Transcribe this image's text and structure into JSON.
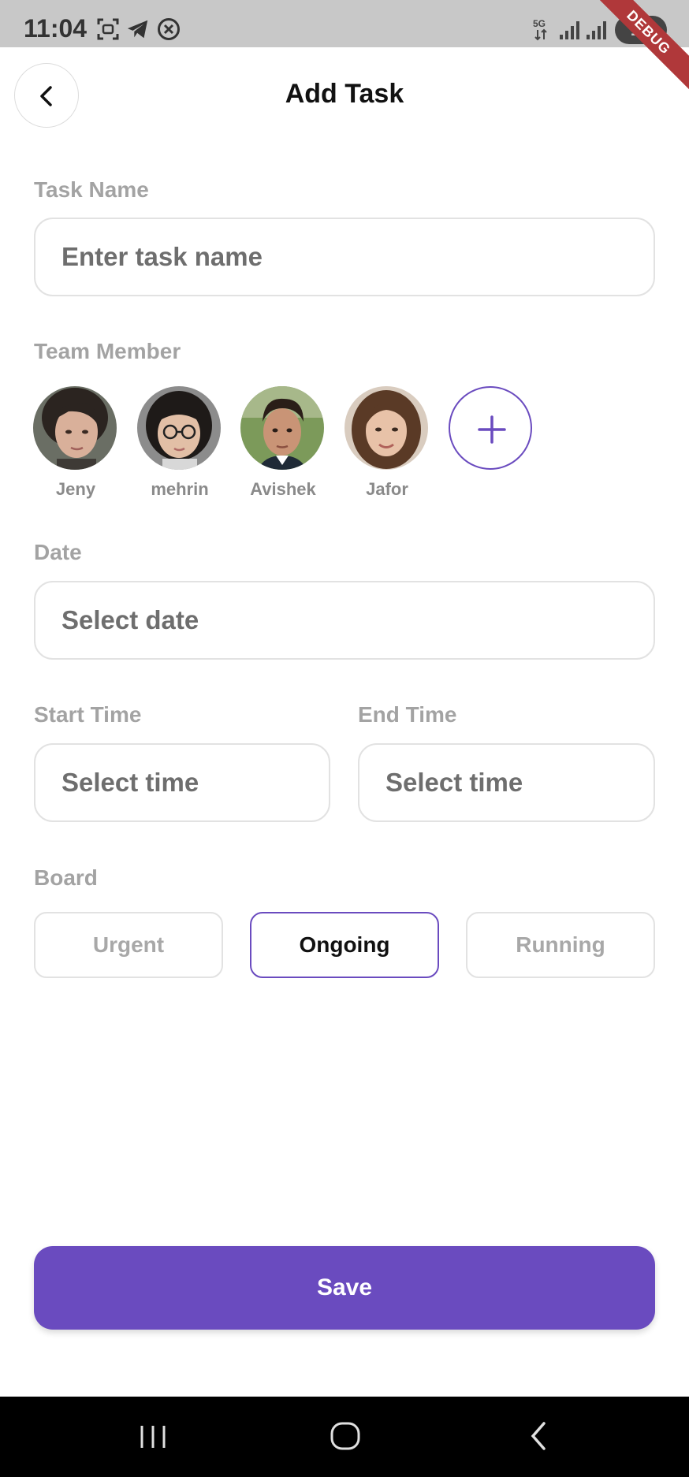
{
  "status_bar": {
    "time": "11:04",
    "battery": "10",
    "debug_label": "DEBUG",
    "icons": [
      "screenshot-icon",
      "telegram-icon",
      "blocked-icon",
      "5g-icon",
      "signal-icon",
      "signal-icon",
      "battery-icon"
    ]
  },
  "header": {
    "title": "Add Task",
    "back_icon": "chevron-left-icon"
  },
  "form": {
    "task_name": {
      "label": "Task Name",
      "placeholder": "Enter task name"
    },
    "team": {
      "label": "Team Member",
      "members": [
        {
          "name": "Jeny"
        },
        {
          "name": "mehrin"
        },
        {
          "name": "Avishek"
        },
        {
          "name": "Jafor"
        }
      ],
      "add_icon": "plus-icon"
    },
    "date": {
      "label": "Date",
      "placeholder": "Select date"
    },
    "start_time": {
      "label": "Start Time",
      "placeholder": "Select time"
    },
    "end_time": {
      "label": "End Time",
      "placeholder": "Select time"
    },
    "board": {
      "label": "Board",
      "options": [
        "Urgent",
        "Ongoing",
        "Running"
      ],
      "selected": "Ongoing"
    }
  },
  "actions": {
    "save_label": "Save"
  },
  "colors": {
    "accent": "#6a4bbf",
    "label": "#a3a3a3",
    "border": "#e2e2e2"
  }
}
